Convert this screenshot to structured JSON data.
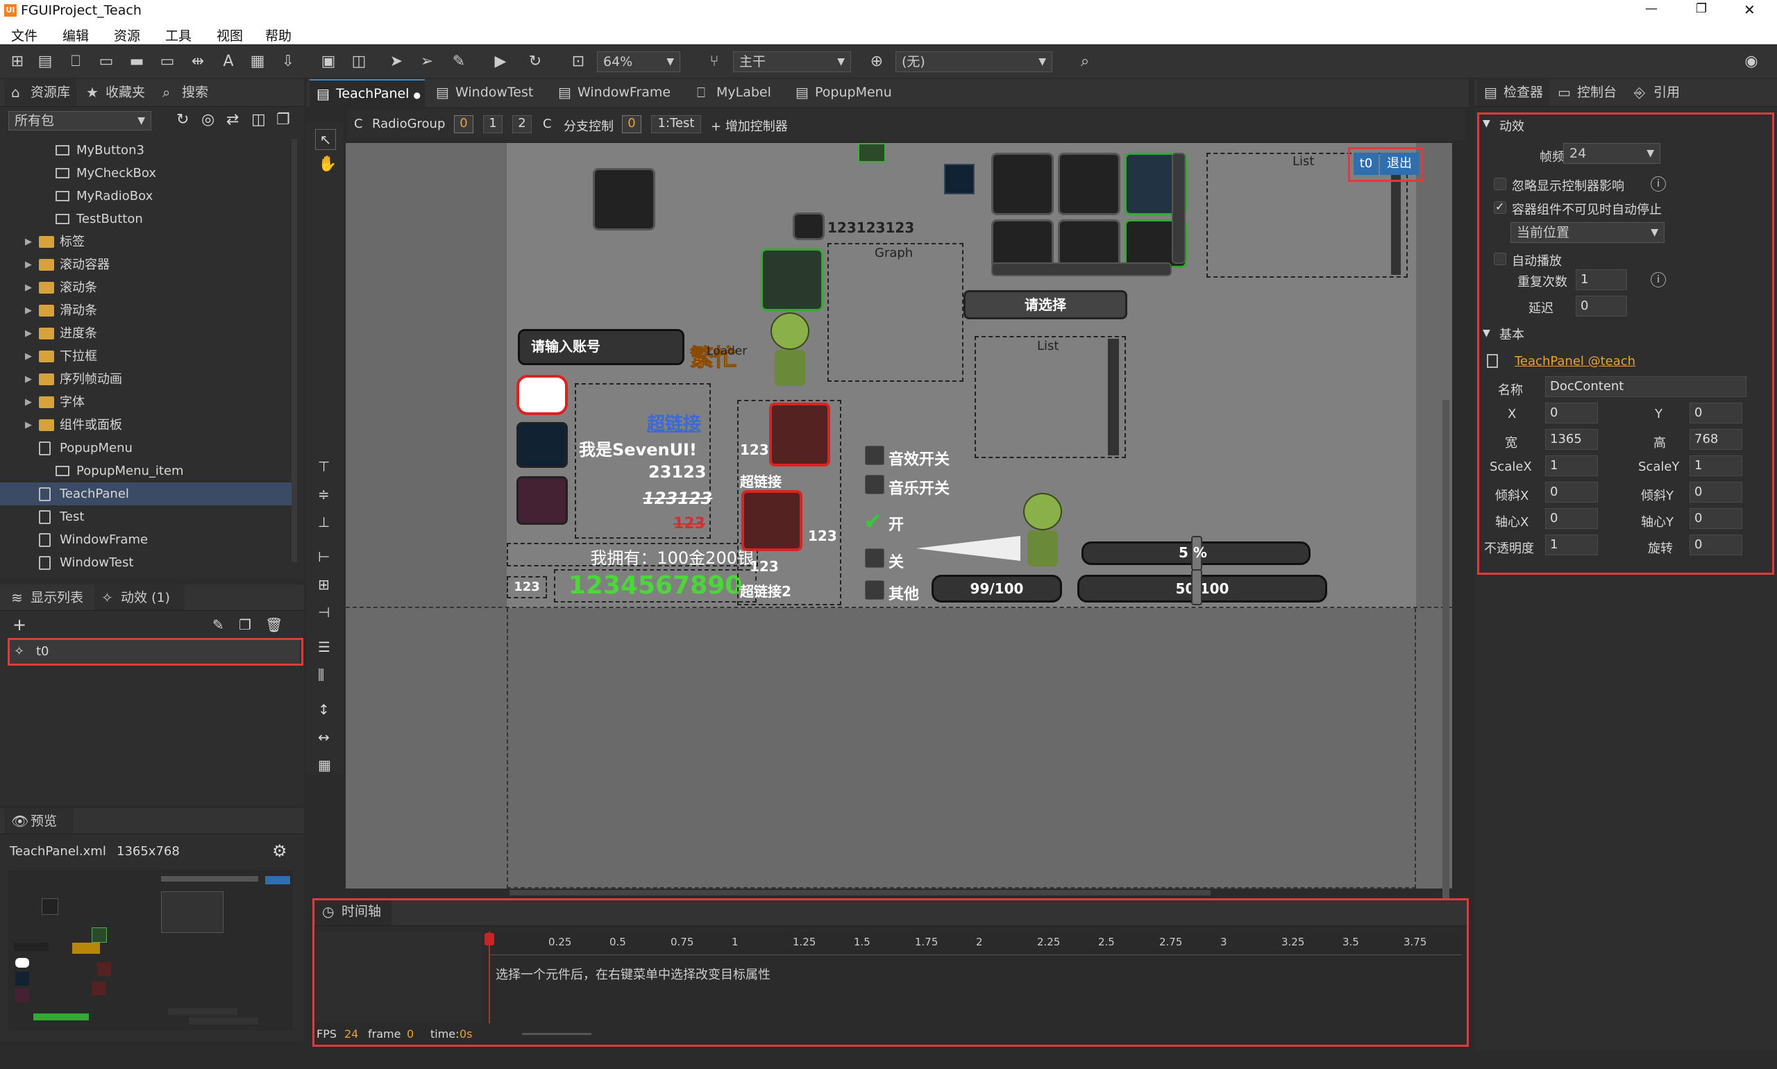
{
  "window": {
    "title": "FGUIProject_Teach",
    "logo": "UI",
    "controls": [
      "—",
      "❐",
      "✕"
    ]
  },
  "menu": [
    "文件",
    "编辑",
    "资源",
    "工具",
    "视图",
    "帮助"
  ],
  "toolbar": {
    "zoom": "64%",
    "branch": "主干",
    "lang": "(无)"
  },
  "library": {
    "tabs": [
      "资源库",
      "收藏夹",
      "搜索"
    ],
    "package": "所有包",
    "items": [
      {
        "label": "MyButton3",
        "type": "comp"
      },
      {
        "label": "MyCheckBox",
        "type": "comp"
      },
      {
        "label": "MyRadioBox",
        "type": "comp"
      },
      {
        "label": "TestButton",
        "type": "comp"
      },
      {
        "label": "标签",
        "type": "folder"
      },
      {
        "label": "滚动容器",
        "type": "folder"
      },
      {
        "label": "滚动条",
        "type": "folder"
      },
      {
        "label": "滑动条",
        "type": "folder"
      },
      {
        "label": "进度条",
        "type": "folder"
      },
      {
        "label": "下拉框",
        "type": "folder"
      },
      {
        "label": "序列帧动画",
        "type": "folder"
      },
      {
        "label": "字体",
        "type": "folder"
      },
      {
        "label": "组件或面板",
        "type": "folder"
      },
      {
        "label": "PopupMenu",
        "type": "file"
      },
      {
        "label": "PopupMenu_item",
        "type": "comp"
      },
      {
        "label": "TeachPanel",
        "type": "file",
        "selected": true
      },
      {
        "label": "Test",
        "type": "file"
      },
      {
        "label": "WindowFrame",
        "type": "file"
      },
      {
        "label": "WindowTest",
        "type": "file"
      }
    ]
  },
  "lower": {
    "tabs": [
      "显示列表",
      "动效 (1)"
    ],
    "transition": "t0"
  },
  "preview": {
    "title": "预览",
    "file": "TeachPanel.xml",
    "size": "1365x768"
  },
  "doc_tabs": [
    {
      "label": "TeachPanel",
      "active": true,
      "dot": "●"
    },
    {
      "label": "WindowTest"
    },
    {
      "label": "WindowFrame"
    },
    {
      "label": "MyLabel"
    },
    {
      "label": "PopupMenu"
    }
  ],
  "ctrl_bar": {
    "c1": "C",
    "radio": "RadioGroup",
    "p0": "0",
    "p1": "1",
    "p2": "2",
    "c2": "C",
    "branch": "分支控制",
    "b0": "0",
    "b1": "1:Test",
    "add": "增加控制器"
  },
  "canvas": {
    "graph": "Graph",
    "list1": "List",
    "list2": "List",
    "loader": "Loader",
    "t0": "t0",
    "exit": "退出",
    "num_label": "123123123",
    "select": "请选择",
    "input_ph": "请输入账号",
    "busy": "繁忙",
    "link": "超链接",
    "seven": "我是SevenUI!",
    "n1": "23123",
    "n2": "123123",
    "n3": "123",
    "money": "我拥有：100金200银",
    "big_num": "1234567890",
    "n123a": "123",
    "n123b": "123",
    "link_a": "超链接",
    "n123c": "123",
    "n123d": "123",
    "link_b": "超链接2",
    "sound": "音效开关",
    "music": "音乐开关",
    "on": "开",
    "off": "关",
    "other": "其他",
    "p50": "5 %",
    "hp": "99/100",
    "hp2": "50/100"
  },
  "timeline": {
    "title": "时间轴",
    "ticks": [
      "0",
      "0.25",
      "0.5",
      "0.75",
      "1",
      "1.25",
      "1.5",
      "1.75",
      "2",
      "2.25",
      "2.5",
      "2.75",
      "3",
      "3.25",
      "3.5",
      "3.75"
    ],
    "hint": "选择一个元件后，在右键菜单中选择改变目标属性",
    "fps_label": "FPS",
    "fps": "24",
    "frame_label": "frame",
    "frame": "0",
    "time_label": "time:",
    "time": "0s"
  },
  "inspector": {
    "tabs": [
      "检查器",
      "控制台",
      "引用"
    ],
    "anim_section": "动效",
    "fps_label": "帧频",
    "fps": "24",
    "ignore": "忽略显示控制器影响",
    "autostop": "容器组件不可见时自动停止",
    "pos": "当前位置",
    "autoplay": "自动播放",
    "repeat_label": "重复次数",
    "repeat": "1",
    "delay_label": "延迟",
    "delay": "0",
    "basic_section": "基本",
    "link": "TeachPanel @teach",
    "name_label": "名称",
    "name": "DocContent",
    "x_label": "X",
    "x": "0",
    "y_label": "Y",
    "y": "0",
    "w_label": "宽",
    "w": "1365",
    "h_label": "高",
    "h": "768",
    "sx_label": "ScaleX",
    "sx": "1",
    "sy_label": "ScaleY",
    "sy": "1",
    "kx_label": "倾斜X",
    "kx": "0",
    "ky_label": "倾斜Y",
    "ky": "0",
    "px_label": "轴心X",
    "px": "0",
    "py_label": "轴心Y",
    "py": "0",
    "alpha_label": "不透明度",
    "alpha": "1",
    "rot_label": "旋转",
    "rot": "0"
  },
  "colors": {
    "accent": "#2f8fd8",
    "highlight": "#e03a3a",
    "link": "#f0a030",
    "selected": "#3b4b66"
  }
}
